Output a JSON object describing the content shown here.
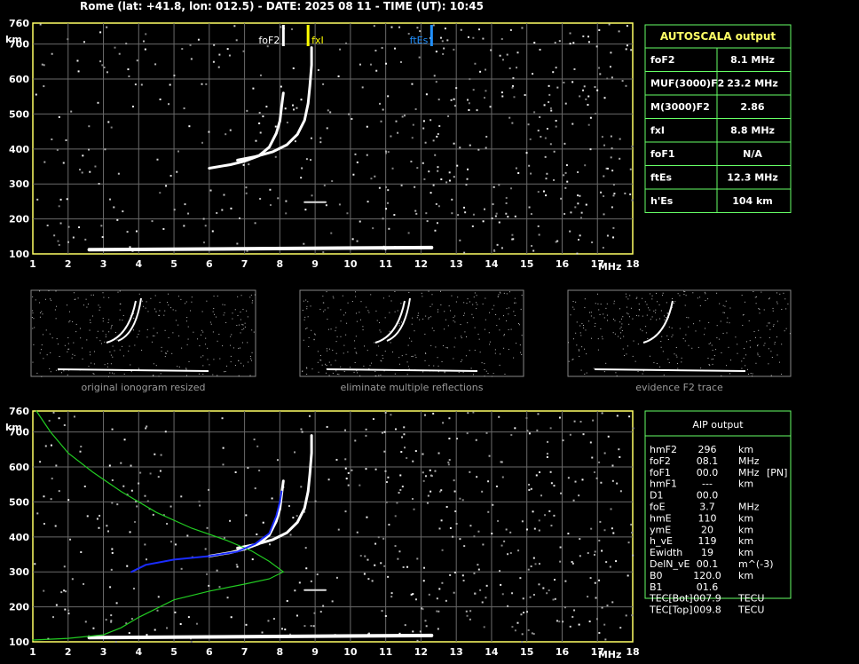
{
  "header": {
    "title": "Rome (lat: +41.8, lon: 012.5) - DATE: 2025 08 11 - TIME (UT): 10:45"
  },
  "colors": {
    "grid": "#6a6a6a",
    "frame": "#ffff66",
    "table_border": "#66ff66",
    "foF2": "#ffffff",
    "fxI": "#ffff00",
    "foF1": "#ff2020",
    "ftEs": "#2090ff",
    "profile": "#22cc22",
    "trace_fit": "#1a2cff"
  },
  "chart_data": [
    {
      "type": "scatter",
      "id": "ionogram-top",
      "x_unit": "MHz",
      "y_unit": "km",
      "xlim": [
        1,
        18
      ],
      "ylim": [
        100,
        760
      ],
      "x_ticks": [
        "1",
        "2",
        "3",
        "4",
        "5",
        "6",
        "7",
        "8",
        "9",
        "10",
        "11",
        "12",
        "13",
        "14",
        "15",
        "16",
        "17",
        "18"
      ],
      "y_ticks": [
        "100",
        "200",
        "300",
        "400",
        "500",
        "600",
        "700",
        "760"
      ],
      "grid": true,
      "markers": [
        {
          "label": "foF2",
          "freq": 8.1,
          "color_key": "foF2",
          "label_side": "left"
        },
        {
          "label": "fxI",
          "freq": 8.8,
          "color_key": "fxI",
          "label_side": "right"
        },
        {
          "label": "ftEs",
          "freq": 12.3,
          "color_key": "ftEs",
          "label_side": "left"
        }
      ],
      "traces": {
        "o_mode": [
          [
            6.0,
            345
          ],
          [
            6.6,
            355
          ],
          [
            7.0,
            365
          ],
          [
            7.4,
            380
          ],
          [
            7.7,
            405
          ],
          [
            7.9,
            445
          ],
          [
            8.0,
            480
          ],
          [
            8.05,
            520
          ],
          [
            8.1,
            560
          ]
        ],
        "x_mode": [
          [
            6.8,
            368
          ],
          [
            7.3,
            378
          ],
          [
            7.8,
            392
          ],
          [
            8.2,
            412
          ],
          [
            8.5,
            442
          ],
          [
            8.7,
            482
          ],
          [
            8.8,
            530
          ],
          [
            8.85,
            580
          ],
          [
            8.9,
            640
          ],
          [
            8.9,
            690
          ]
        ],
        "es_layer": [
          [
            2.6,
            112
          ],
          [
            12.3,
            118
          ]
        ],
        "spur": [
          [
            8.7,
            248
          ],
          [
            9.3,
            248
          ]
        ]
      }
    },
    {
      "type": "scatter",
      "id": "ionogram-aip",
      "x_unit": "MHz",
      "y_unit": "km",
      "xlim": [
        1,
        18
      ],
      "ylim": [
        100,
        760
      ],
      "x_ticks": [
        "1",
        "2",
        "3",
        "4",
        "5",
        "6",
        "7",
        "8",
        "9",
        "10",
        "11",
        "12",
        "13",
        "14",
        "15",
        "16",
        "17",
        "18"
      ],
      "y_ticks": [
        "100",
        "200",
        "300",
        "400",
        "500",
        "600",
        "700",
        "760"
      ],
      "grid": true,
      "profile": [
        [
          1.1,
          760
        ],
        [
          1.5,
          700
        ],
        [
          2.0,
          640
        ],
        [
          2.7,
          585
        ],
        [
          3.5,
          530
        ],
        [
          4.5,
          470
        ],
        [
          5.5,
          425
        ],
        [
          6.5,
          390
        ],
        [
          7.2,
          360
        ],
        [
          7.7,
          330
        ],
        [
          8.1,
          300
        ],
        [
          7.7,
          280
        ],
        [
          7.0,
          265
        ],
        [
          6.0,
          245
        ],
        [
          5.0,
          220
        ],
        [
          4.0,
          170
        ],
        [
          3.5,
          140
        ],
        [
          3.0,
          120
        ],
        [
          2.0,
          110
        ],
        [
          1.0,
          105
        ]
      ],
      "fitted_trace": [
        [
          3.8,
          300
        ],
        [
          4.2,
          320
        ],
        [
          5.0,
          335
        ],
        [
          6.0,
          345
        ],
        [
          6.8,
          358
        ],
        [
          7.3,
          380
        ],
        [
          7.7,
          410
        ],
        [
          7.9,
          460
        ],
        [
          8.0,
          500
        ],
        [
          8.05,
          530
        ]
      ],
      "traces": {
        "o_mode": [
          [
            6.0,
            345
          ],
          [
            6.6,
            355
          ],
          [
            7.0,
            365
          ],
          [
            7.4,
            380
          ],
          [
            7.7,
            405
          ],
          [
            7.9,
            445
          ],
          [
            8.0,
            480
          ],
          [
            8.05,
            520
          ],
          [
            8.1,
            560
          ]
        ],
        "x_mode": [
          [
            6.8,
            368
          ],
          [
            7.3,
            378
          ],
          [
            7.8,
            392
          ],
          [
            8.2,
            412
          ],
          [
            8.5,
            442
          ],
          [
            8.7,
            482
          ],
          [
            8.8,
            530
          ],
          [
            8.85,
            580
          ],
          [
            8.9,
            640
          ],
          [
            8.9,
            690
          ]
        ],
        "es_layer": [
          [
            2.6,
            112
          ],
          [
            12.3,
            118
          ]
        ],
        "spur": [
          [
            8.7,
            248
          ],
          [
            9.3,
            248
          ]
        ]
      }
    }
  ],
  "thumbnails": [
    {
      "caption": "original ionogram resized"
    },
    {
      "caption": "eliminate multiple reflections"
    },
    {
      "caption": "evidence F2 trace"
    }
  ],
  "autoscala": {
    "title": "AUTOSCALA output",
    "rows": [
      {
        "label": "foF2",
        "value": "8.1 MHz",
        "color_key": "foF2"
      },
      {
        "label": "MUF(3000)F2",
        "value": "23.2 MHz",
        "color_key": "foF2"
      },
      {
        "label": "M(3000)F2",
        "value": "2.86",
        "color_key": "foF2"
      },
      {
        "label": "fxI",
        "value": "8.8 MHz",
        "color_key": "fxI"
      },
      {
        "label": "foF1",
        "value": "N/A",
        "color_key": "foF1"
      },
      {
        "label": "ftEs",
        "value": "12.3 MHz",
        "color_key": "ftEs"
      },
      {
        "label": "h'Es",
        "value": "104     km",
        "color_key": "foF2"
      }
    ]
  },
  "aip": {
    "title": "AIP output",
    "rows": [
      {
        "name": "hmF2",
        "value": "296",
        "unit": "km",
        "extra": ""
      },
      {
        "name": "foF2",
        "value": "08.1",
        "unit": "MHz",
        "extra": ""
      },
      {
        "name": "foF1",
        "value": "00.0",
        "unit": "MHz",
        "extra": "[PN]"
      },
      {
        "name": "hmF1",
        "value": "---",
        "unit": "km",
        "extra": ""
      },
      {
        "name": "D1",
        "value": "00.0",
        "unit": "",
        "extra": ""
      },
      {
        "name": "foE",
        "value": "3.7",
        "unit": "MHz",
        "extra": ""
      },
      {
        "name": "hmE",
        "value": "110",
        "unit": "km",
        "extra": ""
      },
      {
        "name": "ymE",
        "value": "20",
        "unit": "km",
        "extra": ""
      },
      {
        "name": "h_vE",
        "value": "119",
        "unit": "km",
        "extra": ""
      },
      {
        "name": "Ewidth",
        "value": "19",
        "unit": "km",
        "extra": ""
      },
      {
        "name": "DelN_vE",
        "value": "00.1",
        "unit": "m^(-3)",
        "extra": ""
      },
      {
        "name": "B0",
        "value": "120.0",
        "unit": "km",
        "extra": ""
      },
      {
        "name": "B1",
        "value": "01.6",
        "unit": "",
        "extra": ""
      },
      {
        "name": "TEC[Bot]",
        "value": "007.9",
        "unit": "TECU",
        "extra": ""
      },
      {
        "name": "TEC[Top]",
        "value": "009.8",
        "unit": "TECU",
        "extra": ""
      }
    ]
  }
}
